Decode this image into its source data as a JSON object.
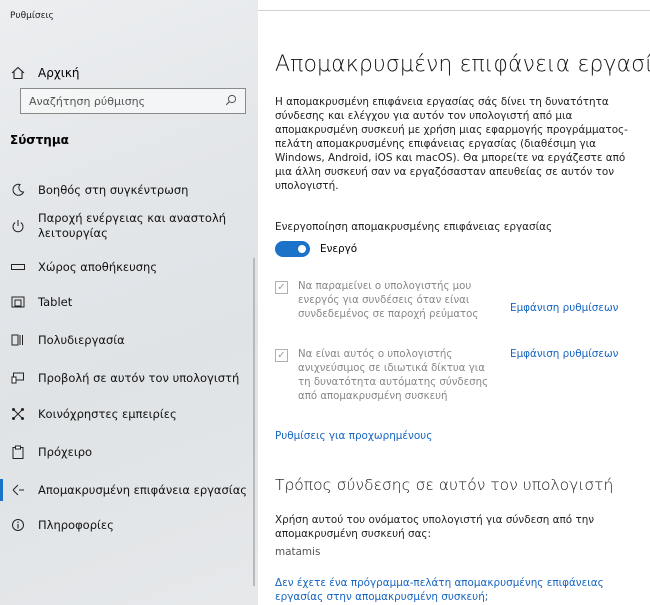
{
  "app": {
    "title": "Ρυθμίσεις"
  },
  "sidebar": {
    "home_label": "Αρχική",
    "search_placeholder": "Αναζήτηση ρύθμισης",
    "section_title": "Σύστημα",
    "items": [
      {
        "label": "Βοηθός στη συγκέντρωση",
        "icon": "moon-icon"
      },
      {
        "label": "Παροχή ενέργειας και αναστολή λειτουργίας",
        "icon": "power-icon"
      },
      {
        "label": "Χώρος αποθήκευσης",
        "icon": "storage-icon"
      },
      {
        "label": "Tablet",
        "icon": "tablet-icon"
      },
      {
        "label": "Πολυδιεργασία",
        "icon": "multitasking-icon"
      },
      {
        "label": "Προβολή σε αυτόν τον υπολογιστή",
        "icon": "projection-icon"
      },
      {
        "label": "Κοινόχρηστες εμπειρίες",
        "icon": "shared-experiences-icon"
      },
      {
        "label": "Πρόχειρο",
        "icon": "clipboard-icon"
      },
      {
        "label": "Απομακρυσμένη επιφάνεια εργασίας",
        "icon": "remote-desktop-icon",
        "active": true
      },
      {
        "label": "Πληροφορίες",
        "icon": "info-icon"
      }
    ]
  },
  "main": {
    "title": "Απομακρυσμένη επιφάνεια εργασίας",
    "description": "Η απομακρυσμένη επιφάνεια εργασίας σάς δίνει τη δυνατότητα σύνδεσης και ελέγχου για αυτόν τον υπολογιστή από μια απομακρυσμένη συσκευή με χρήση μιας εφαρμογής προγράμματος-πελάτη απομακρυσμένης επιφάνειας εργασίας (διαθέσιμη για Windows, Android, iOS και macOS). Θα μπορείτε να εργάζεστε από μια άλλη συσκευή σαν να εργαζόσασταν απευθείας σε αυτόν τον υπολογιστή.",
    "enable_label": "Ενεργοποίηση απομακρυσμένης επιφάνειας εργασίας",
    "toggle_state": "Ενεργό",
    "options": [
      {
        "text": "Να παραμείνει ο υπολογιστής μου ενεργός για συνδέσεις όταν είναι συνδεδεμένος σε παροχή ρεύματος",
        "link": "Εμφάνιση ρυθμίσεων",
        "checked": true
      },
      {
        "text": "Να είναι αυτός ο υπολογιστής ανιχνεύσιμος σε ιδιωτικά δίκτυα για τη δυνατότητα αυτόματης σύνδεσης από απομακρυσμένη συσκευή",
        "link": "Εμφάνιση ρυθμίσεων",
        "checked": true
      }
    ],
    "advanced_link": "Ρυθμίσεις για προχωρημένους",
    "how_title": "Τρόπος σύνδεσης σε αυτόν τον υπολογιστή",
    "how_desc": "Χρήση αυτού του ονόματος υπολογιστή για σύνδεση από την απομακρυσμένη συσκευή σας:",
    "pc_name": "matamis",
    "bottom_link": "Δεν έχετε ένα πρόγραμμα-πελάτη απομακρυσμένης επιφάνειας εργασίας στην απομακρυσμένη συσκευή;"
  },
  "colors": {
    "accent": "#1a73c9",
    "link": "#1565c0"
  }
}
